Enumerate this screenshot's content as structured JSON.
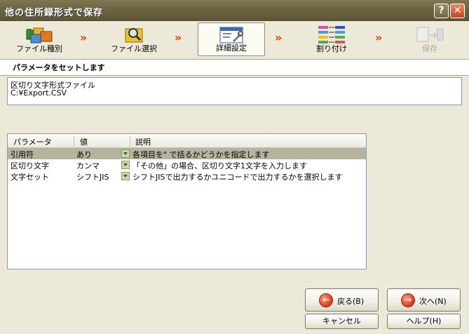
{
  "window": {
    "title": "他の住所録形式で保存",
    "help_label": "?",
    "close_label": "✕"
  },
  "steps": [
    {
      "label": "ファイル種別",
      "icon": "folders-icon",
      "state": "done"
    },
    {
      "label": "ファイル選択",
      "icon": "folder-search-icon",
      "state": "done"
    },
    {
      "label": "詳細設定",
      "icon": "settings-window-icon",
      "state": "active"
    },
    {
      "label": "割り付け",
      "icon": "mapping-icon",
      "state": "pending"
    },
    {
      "label": "保存",
      "icon": "save-disk-icon",
      "state": "disabled"
    }
  ],
  "step_arrow": "»",
  "heading": "パラメータをセットします",
  "info": {
    "line1": "区切り文字形式ファイル",
    "line2": "C:¥Export.CSV"
  },
  "grid": {
    "columns": [
      "パラメータ",
      "値",
      "説明"
    ],
    "rows": [
      {
        "param": "引用符",
        "value": "あり",
        "desc": "各項目を\" で括るかどうかを指定します",
        "selected": true
      },
      {
        "param": "区切り文字",
        "value": "カンマ",
        "desc": "「その他」の場合、区切り文字1文字を入力します",
        "selected": false
      },
      {
        "param": "文字セット",
        "value": "シフトJIS",
        "desc": "シフトJISで出力するかユニコードで出力するかを選択します",
        "selected": false
      }
    ]
  },
  "buttons": {
    "back": "戻る(B)",
    "next": "次へ(N)",
    "cancel": "キャンセル",
    "help": "ヘルプ(H)"
  },
  "colors": {
    "accent_arrow": "#e23a1c",
    "selected_row": "#b6b39f",
    "button_circle": "#d93a16"
  }
}
